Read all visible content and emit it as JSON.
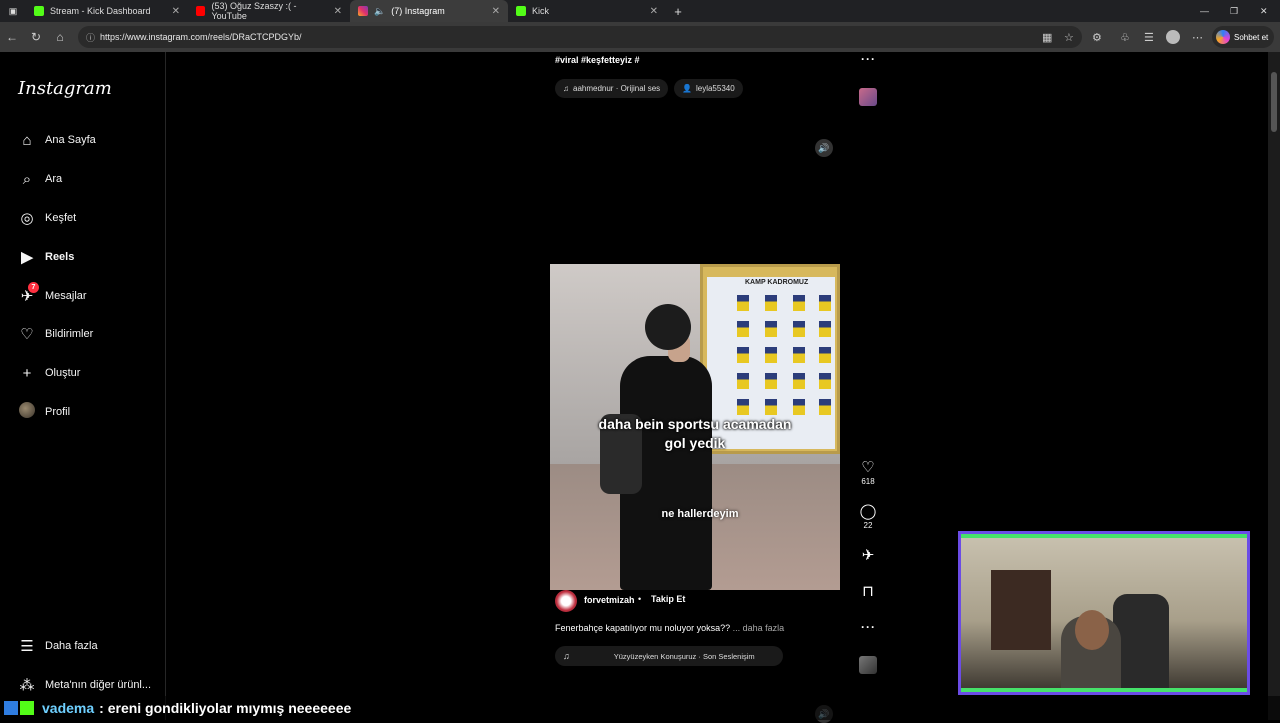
{
  "browser": {
    "tabs": [
      {
        "title": "Stream - Kick Dashboard",
        "color": "#53fc18"
      },
      {
        "title": "(53) Oğuz Szaszy :( - YouTube",
        "color": "#ff0000"
      },
      {
        "title": "(7) Instagram",
        "color": "#e1306c"
      },
      {
        "title": "Kick",
        "color": "#53fc18"
      }
    ],
    "url": "https://www.instagram.com/reels/DRaCTCPDGYb/",
    "chat_button": "Sohbet et"
  },
  "sidebar": {
    "logo": "Instagram",
    "items": [
      {
        "label": "Ana Sayfa",
        "icon": "home-icon",
        "glyph": "⌂"
      },
      {
        "label": "Ara",
        "icon": "search-icon",
        "glyph": "⌕"
      },
      {
        "label": "Keşfet",
        "icon": "compass-icon",
        "glyph": "◎"
      },
      {
        "label": "Reels",
        "icon": "reels-icon",
        "glyph": "▶"
      },
      {
        "label": "Mesajlar",
        "icon": "messenger-icon",
        "glyph": "✈"
      },
      {
        "label": "Bildirimler",
        "icon": "heart-icon",
        "glyph": "♡"
      },
      {
        "label": "Oluştur",
        "icon": "plus-icon",
        "glyph": "+"
      },
      {
        "label": "Profil",
        "icon": "avatar",
        "glyph": ""
      }
    ],
    "messages_badge": "7",
    "more": "Daha fazla",
    "meta": "Meta'nın diğer ürünl..."
  },
  "reel_prev": {
    "hashtags": "#viral #keşfetteyiz #",
    "audio_chip": "aahmednur · Orijinal ses",
    "user_chip": "leyla55340"
  },
  "reel": {
    "board_title": "KAMP KADROMUZ",
    "caption_line1": "daha bein sportsu acamadan",
    "caption_line2": "gol yedik",
    "caption_bottom": "ne hallerdeyim",
    "likes": "618",
    "comments": "22",
    "username": "forvetmizah",
    "dot": "•",
    "follow": "Takip Et",
    "description": "Fenerbahçe kapatılıyor mu noluyor yoksa??",
    "more": "... daha fazla",
    "music": "Yüzyüzeyken Konuşuruz · Son Seslenişim"
  },
  "overlay": {
    "chat_user": "vadema",
    "chat_message": ": ereni gondikliyolar mıymış neeeeeee",
    "accent": "#53fc18"
  }
}
